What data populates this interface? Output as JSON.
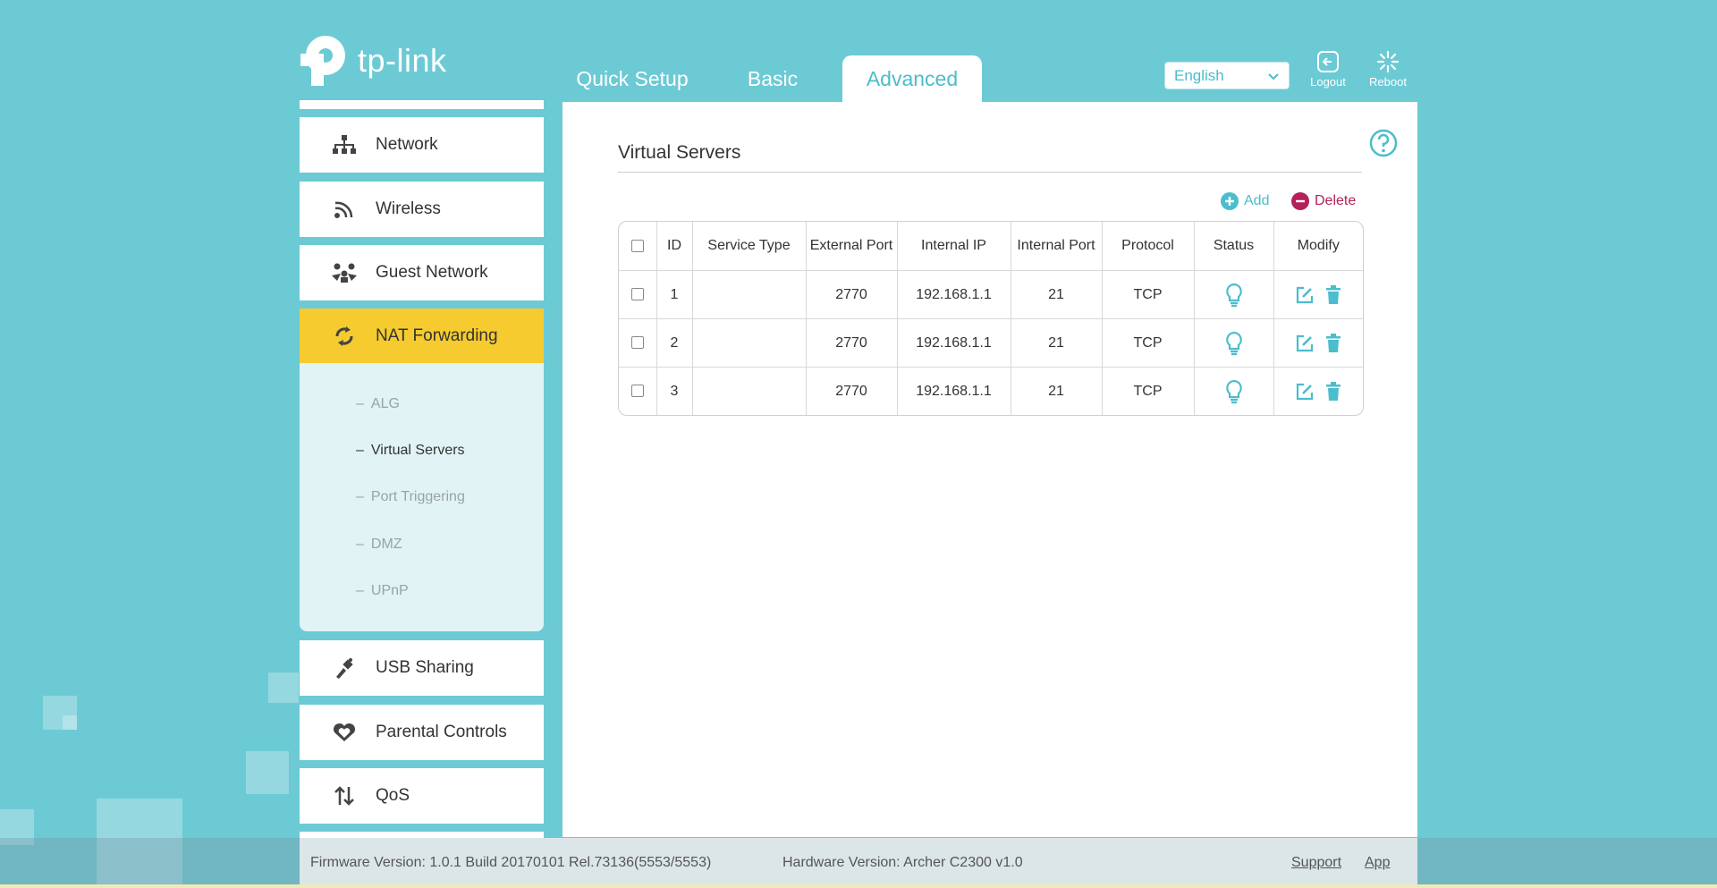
{
  "brand": {
    "name": "tp-link"
  },
  "nav_tabs": [
    {
      "label": "Quick Setup",
      "active": false
    },
    {
      "label": "Basic",
      "active": false
    },
    {
      "label": "Advanced",
      "active": true
    }
  ],
  "header": {
    "language": "English",
    "logout_label": "Logout",
    "reboot_label": "Reboot"
  },
  "sidebar": {
    "items": [
      {
        "label": "Network",
        "icon": "network-icon"
      },
      {
        "label": "Wireless",
        "icon": "wireless-icon"
      },
      {
        "label": "Guest Network",
        "icon": "guest-network-icon"
      },
      {
        "label": "NAT Forwarding",
        "icon": "nat-forwarding-icon",
        "active": true
      },
      {
        "label": "USB Sharing",
        "icon": "usb-icon"
      },
      {
        "label": "Parental Controls",
        "icon": "parental-controls-icon"
      },
      {
        "label": "QoS",
        "icon": "qos-icon"
      }
    ],
    "submenu": [
      {
        "label": "ALG"
      },
      {
        "label": "Virtual Servers",
        "active": true
      },
      {
        "label": "Port Triggering"
      },
      {
        "label": "DMZ"
      },
      {
        "label": "UPnP"
      }
    ]
  },
  "main": {
    "title": "Virtual Servers",
    "add_label": "Add",
    "delete_label": "Delete",
    "table": {
      "columns": [
        "ID",
        "Service Type",
        "External Port",
        "Internal IP",
        "Internal Port",
        "Protocol",
        "Status",
        "Modify"
      ],
      "rows": [
        {
          "id": "1",
          "service_type": "",
          "external_port": "2770",
          "internal_ip": "192.168.1.1",
          "internal_port": "21",
          "protocol": "TCP"
        },
        {
          "id": "2",
          "service_type": "",
          "external_port": "2770",
          "internal_ip": "192.168.1.1",
          "internal_port": "21",
          "protocol": "TCP"
        },
        {
          "id": "3",
          "service_type": "",
          "external_port": "2770",
          "internal_ip": "192.168.1.1",
          "internal_port": "21",
          "protocol": "TCP"
        }
      ]
    }
  },
  "footer": {
    "firmware": "Firmware Version: 1.0.1 Build 20170101 Rel.73136(5553/5553)",
    "hardware": "Hardware Version: Archer C2300 v1.0",
    "support_label": "Support",
    "app_label": "App"
  },
  "colors": {
    "background": "#6ccad5",
    "accent": "#4bbdcc",
    "active_menu": "#f6cb2f",
    "delete": "#b4215a"
  }
}
